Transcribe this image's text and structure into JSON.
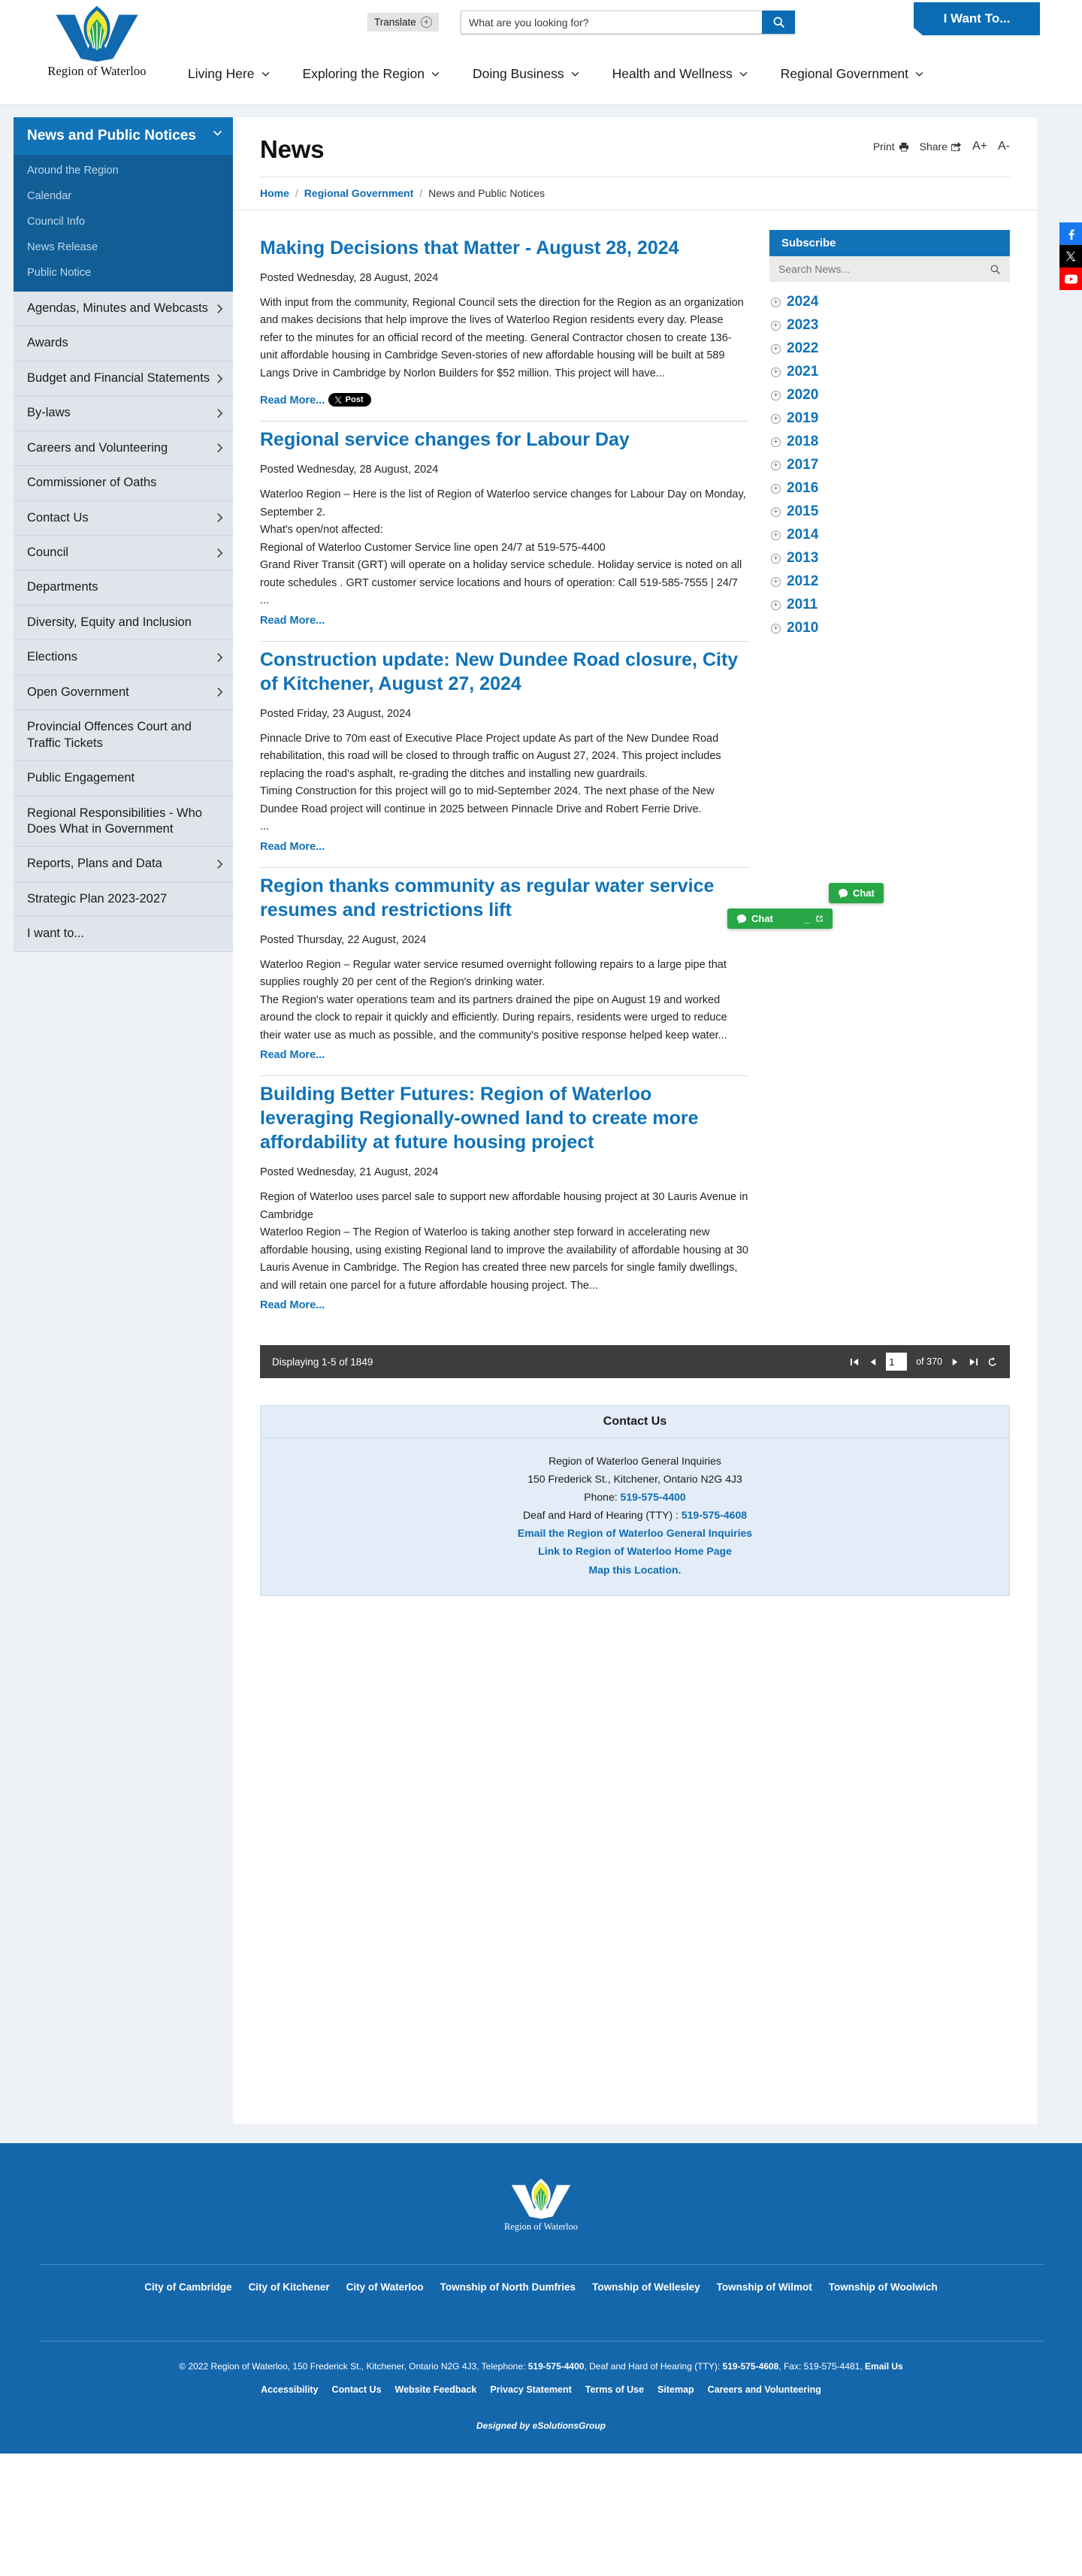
{
  "header": {
    "logo_label": "Region of Waterloo",
    "translate_label": "Translate",
    "search_placeholder": "What are you looking for?",
    "search_value": "",
    "iwant_label": "I Want To...",
    "nav": [
      {
        "label": "Living Here"
      },
      {
        "label": "Exploring the Region"
      },
      {
        "label": "Doing Business"
      },
      {
        "label": "Health and Wellness"
      },
      {
        "label": "Regional Government"
      }
    ]
  },
  "sidebar": {
    "active_title": "News and Public Notices",
    "sub_items": [
      {
        "label": "Around the Region"
      },
      {
        "label": "Calendar"
      },
      {
        "label": "Council Info"
      },
      {
        "label": "News Release"
      },
      {
        "label": "Public Notice"
      }
    ],
    "items": [
      {
        "label": "Agendas, Minutes and Webcasts",
        "chevron": true
      },
      {
        "label": "Awards",
        "chevron": false
      },
      {
        "label": "Budget and Financial Statements",
        "chevron": true
      },
      {
        "label": "By-laws",
        "chevron": true
      },
      {
        "label": "Careers and Volunteering",
        "chevron": true
      },
      {
        "label": "Commissioner of Oaths",
        "chevron": false
      },
      {
        "label": "Contact Us",
        "chevron": true
      },
      {
        "label": "Council",
        "chevron": true
      },
      {
        "label": "Departments",
        "chevron": false
      },
      {
        "label": "Diversity, Equity and Inclusion",
        "chevron": false
      },
      {
        "label": "Elections",
        "chevron": true
      },
      {
        "label": "Open Government",
        "chevron": true
      },
      {
        "label": "Provincial Offences Court and Traffic Tickets",
        "chevron": false
      },
      {
        "label": "Public Engagement",
        "chevron": false
      },
      {
        "label": "Regional Responsibilities - Who Does What in Government",
        "chevron": false
      },
      {
        "label": "Reports, Plans and Data",
        "chevron": true
      },
      {
        "label": "Strategic Plan 2023-2027",
        "chevron": false
      },
      {
        "label": "I want to...",
        "chevron": false
      }
    ]
  },
  "main": {
    "title": "News",
    "tools": {
      "print": "Print",
      "share": "Share",
      "font_increase": "A+",
      "font_decrease": "A-"
    },
    "breadcrumb": {
      "home": "Home",
      "section": "Regional Government",
      "current": "News and Public Notices",
      "separator": "/"
    },
    "articles": [
      {
        "title": "Making Decisions that Matter - August 28, 2024",
        "posted": "Posted Wednesday, 28 August, 2024",
        "body": "With input from the community, Regional Council sets the direction for the Region as an organization and makes decisions that help improve the lives of Waterloo Region residents every day. Please refer to the minutes for an official record of the meeting. General Contractor chosen to create 136-unit affordable housing in Cambridge Seven-stories of new affordable housing will be built at 589 Langs Drive in Cambridge by Norlon Builders for $52 million. This project will have...",
        "read_more": "Read More...",
        "has_x_post": true,
        "x_post_label": "Post"
      },
      {
        "title": "Regional service changes for Labour Day",
        "posted": "Posted Wednesday, 28 August, 2024",
        "body": "Waterloo Region – Here is the list of Region of Waterloo service changes for Labour Day on Monday, September 2.\nWhat's open/not affected:\nRegional of Waterloo Customer Service line  open 24/7 at 519-575-4400\nGrand River Transit (GRT) will operate on a holiday service schedule. Holiday service is noted on all  route schedules . GRT customer service locations and hours of operation: Call 519-585-7555 | 24/7\n...",
        "read_more": "Read More...",
        "has_x_post": false
      },
      {
        "title": "Construction update: New Dundee Road closure, City of Kitchener, August 27, 2024",
        "posted": "Posted Friday, 23 August, 2024",
        "body": "Pinnacle Drive to 70m east of Executive Place Project update As part of the New Dundee Road rehabilitation, this road will be closed to through traffic on August 27, 2024. This project includes replacing the road's asphalt, re-grading the ditches and installing new guardrails.\nTiming  Construction for this project will go to mid-September 2024. The next phase of the New Dundee Road project will continue in 2025 between Pinnacle Drive and Robert Ferrie Drive.\n...",
        "read_more": "Read More...",
        "has_x_post": false
      },
      {
        "title": "Region thanks community as regular water service resumes and restrictions lift",
        "posted": "Posted Thursday, 22 August, 2024",
        "body": "Waterloo Region – Regular water service resumed overnight following repairs to a large pipe that supplies roughly 20 per cent of the Region's drinking water.\nThe Region's water operations team and its partners drained the pipe on August 19 and worked around the clock to repair it quickly and efficiently. During repairs, residents were urged to reduce their water use as much as possible, and the community's positive response helped keep water...",
        "read_more": "Read More...",
        "has_x_post": false
      },
      {
        "title": "Building Better Futures: Region of Waterloo leveraging Regionally-owned land to create more affordability at future housing project",
        "posted": "Posted Wednesday, 21 August, 2024",
        "body": "Region of Waterloo uses parcel sale to support new affordable housing project at 30 Lauris Avenue in Cambridge\nWaterloo Region – The Region of Waterloo is taking another step forward in accelerating new affordable housing, using existing Regional land to improve the availability of affordable housing at 30 Lauris Avenue in Cambridge. The Region has created three new parcels for single family dwellings, and will retain one parcel for a future affordable housing project. The...",
        "read_more": "Read More...",
        "has_x_post": false
      }
    ],
    "pager": {
      "count_text": "Displaying 1-5 of 1849",
      "page_value": "1",
      "of_text": "of 370"
    }
  },
  "rail": {
    "subscribe_label": "Subscribe",
    "search_placeholder": "Search News...",
    "search_value": "",
    "years": [
      "2024",
      "2023",
      "2022",
      "2021",
      "2020",
      "2019",
      "2018",
      "2017",
      "2016",
      "2015",
      "2014",
      "2013",
      "2012",
      "2011",
      "2010"
    ]
  },
  "contact": {
    "heading": "Contact Us",
    "org": "Region of Waterloo General Inquiries",
    "address": "150 Frederick St., Kitchener, Ontario N2G 4J3",
    "phone_label": "Phone:",
    "phone": "519-575-4400",
    "tty_label": "Deaf and Hard of Hearing (TTY) :",
    "tty": "519-575-4608",
    "email_link": "Email the Region of Waterloo General Inquiries",
    "home_link": "Link to Region of Waterloo Home Page",
    "map_link": "Map this Location."
  },
  "social": [
    {
      "name": "facebook",
      "glyph": "f"
    },
    {
      "name": "x-twitter",
      "glyph": "X"
    },
    {
      "name": "youtube",
      "glyph": "▶"
    }
  ],
  "chat": {
    "primary_label": "Chat",
    "secondary_label": "Chat"
  },
  "footer": {
    "logo_label": "Region of Waterloo",
    "municipalities": [
      "City of Cambridge",
      "City of Kitchener",
      "City of Waterloo",
      "Township of North Dumfries",
      "Township of Wellesley",
      "Township of Wilmot",
      "Township of Woolwich"
    ],
    "legal_prefix": "© 2022 Region of Waterloo, 150 Frederick St., Kitchener, Ontario N2G 4J3, Telephone:",
    "legal_phone": "519-575-4400",
    "legal_mid": ", Deaf and Hard of Hearing (TTY):",
    "legal_tty": "519-575-4608",
    "legal_fax": ", Fax: 519-575-4481,",
    "legal_email": "Email Us",
    "links": [
      "Accessibility",
      "Contact Us",
      "Website Feedback",
      "Privacy Statement",
      "Terms of Use",
      "Sitemap",
      "Careers and Volunteering"
    ],
    "designed_by": "Designed by eSolutionsGroup"
  },
  "colors": {
    "brand_blue": "#1273b8",
    "deep_blue": "#115e96",
    "footer_blue": "#1567ac",
    "link_blue": "#1072b8",
    "chat_green": "#27a745",
    "pager_dark": "#3d3d3d"
  }
}
